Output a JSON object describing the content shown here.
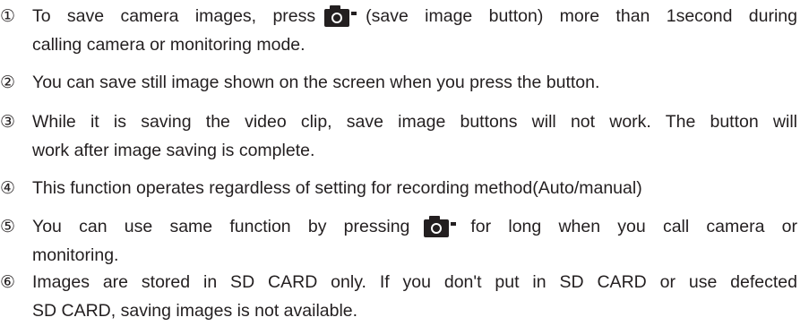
{
  "items": [
    {
      "number": "①",
      "lines": [
        {
          "before": "To save camera images, press",
          "after": "(save image button) more than 1second during"
        },
        {
          "text": "calling camera or monitoring mode."
        }
      ]
    },
    {
      "number": "②",
      "lines": [
        {
          "text": "You can save still image shown on the screen when you press the button."
        }
      ]
    },
    {
      "number": "③",
      "lines": [
        {
          "text": "While it is saving the video clip, save image buttons will not work. The button will"
        },
        {
          "text": "work after image saving is complete."
        }
      ]
    },
    {
      "number": "④",
      "lines": [
        {
          "text": "This function operates regardless of setting for recording method(Auto/manual)"
        }
      ]
    },
    {
      "number": "⑤",
      "lines": [
        {
          "before": "You can use same function by pressing",
          "after": "for long when you call camera or"
        },
        {
          "text": "monitoring."
        }
      ]
    },
    {
      "number": "⑥",
      "lines": [
        {
          "text": "Images are stored in SD CARD only. If you don't put in SD CARD or use defected"
        },
        {
          "text": "SD CARD, saving images is not available."
        }
      ]
    }
  ],
  "icons": {
    "save_image_button": "camera-icon",
    "icon_color": "#231f20"
  }
}
